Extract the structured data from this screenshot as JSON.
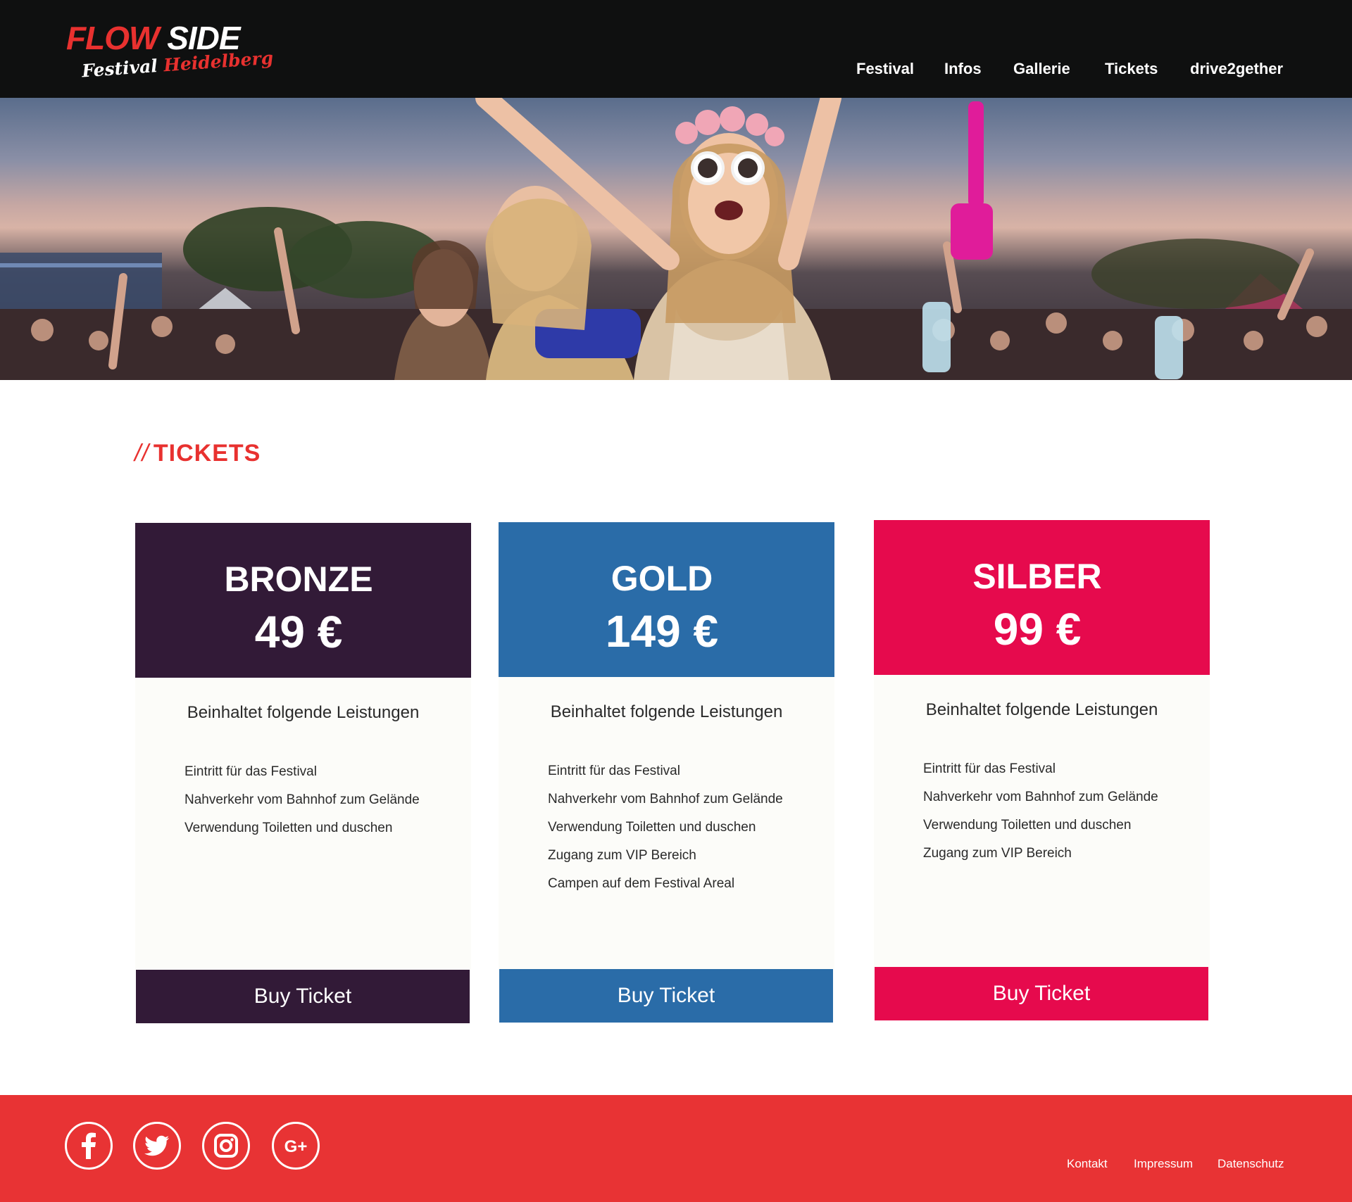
{
  "header": {
    "logo": {
      "main_a": "FLOW",
      "main_b": "SIDE",
      "sub_a": "Festival",
      "sub_b": "Heidelberg"
    },
    "nav": [
      {
        "label": "Festival"
      },
      {
        "label": "Infos"
      },
      {
        "label": "Gallerie"
      },
      {
        "label": "Tickets"
      },
      {
        "label": "drive2gether"
      }
    ]
  },
  "section": {
    "slashes": "//",
    "title": "TICKETS"
  },
  "cards": [
    {
      "name": "BRONZE",
      "price": "49 €",
      "subtitle": "Beinhaltet folgende Leistungen",
      "features": [
        "Eintritt für das Festival",
        "Nahverkehr vom Bahnhof zum Gelände",
        "Verwendung Toiletten und duschen"
      ],
      "button": "Buy Ticket",
      "color": "#321a37"
    },
    {
      "name": "GOLD",
      "price": "149 €",
      "subtitle": "Beinhaltet folgende Leistungen",
      "features": [
        "Eintritt für das Festival",
        "Nahverkehr vom Bahnhof zum Gelände",
        "Verwendung Toiletten und duschen",
        "Zugang zum VIP Bereich",
        "Campen auf dem Festival Areal"
      ],
      "button": "Buy Ticket",
      "color": "#2a6ca8"
    },
    {
      "name": "SILBER",
      "price": "99 €",
      "subtitle": "Beinhaltet folgende Leistungen",
      "features": [
        "Eintritt für das Festival",
        "Nahverkehr vom Bahnhof zum Gelände",
        "Verwendung Toiletten und duschen",
        "Zugang zum VIP Bereich"
      ],
      "button": "Buy Ticket",
      "color": "#e60a4d"
    }
  ],
  "footer": {
    "social": [
      "facebook-icon",
      "twitter-icon",
      "instagram-icon",
      "google-plus-icon"
    ],
    "google_plus_glyph": "G+",
    "links": [
      "Kontakt",
      "Impressum",
      "Datenschutz"
    ]
  },
  "colors": {
    "topbar": "#0f1010",
    "accent": "#e8312f",
    "footer": "#e83334"
  }
}
